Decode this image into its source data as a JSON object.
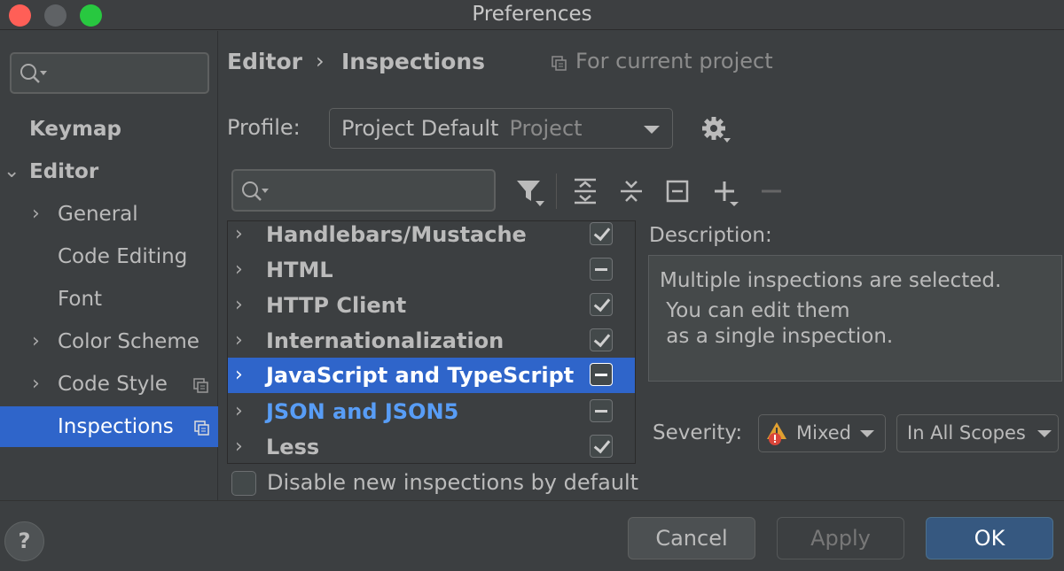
{
  "window": {
    "title": "Preferences"
  },
  "sidebar": {
    "items": [
      {
        "label": "Keymap"
      },
      {
        "label": "Editor"
      },
      {
        "label": "General"
      },
      {
        "label": "Code Editing"
      },
      {
        "label": "Font"
      },
      {
        "label": "Color Scheme"
      },
      {
        "label": "Code Style"
      },
      {
        "label": "Inspections",
        "selected": true
      }
    ]
  },
  "header": {
    "breadcrumb": [
      "Editor",
      "Inspections"
    ],
    "separator": "›",
    "scope_note": "For current project"
  },
  "profile": {
    "label": "Profile:",
    "value": "Project Default",
    "sub": "Project"
  },
  "tree": {
    "rows": [
      {
        "name": "Handlebars/Mustache",
        "state": "checked"
      },
      {
        "name": "HTML",
        "state": "mixed"
      },
      {
        "name": "HTTP Client",
        "state": "checked"
      },
      {
        "name": "Internationalization",
        "state": "checked"
      },
      {
        "name": "JavaScript and TypeScript",
        "state": "mixed",
        "selected": true
      },
      {
        "name": "JSON and JSON5",
        "state": "mixed",
        "link": true
      },
      {
        "name": "Less",
        "state": "checked"
      }
    ]
  },
  "description": {
    "label": "Description:",
    "lines": [
      "Multiple inspections are selected.",
      " You can edit them",
      " as a single inspection."
    ]
  },
  "severity": {
    "label": "Severity:",
    "value": "Mixed",
    "scope": "In All Scopes"
  },
  "disable_new": {
    "label": "Disable new inspections by default"
  },
  "buttons": {
    "help": "?",
    "cancel": "Cancel",
    "apply": "Apply",
    "ok": "OK"
  },
  "colors": {
    "accent": "#2f65ca",
    "link": "#589df6",
    "primary_button": "#365880"
  }
}
